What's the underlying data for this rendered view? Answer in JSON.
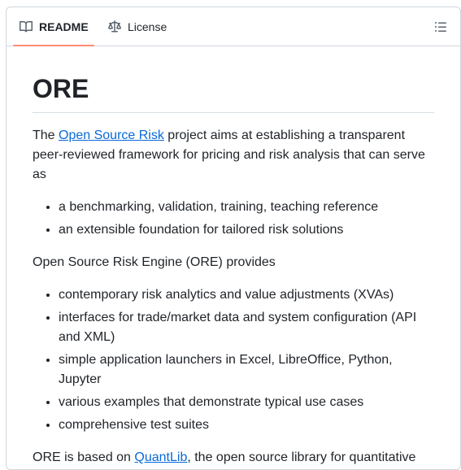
{
  "tabs": {
    "readme": "README",
    "license": "License"
  },
  "readme": {
    "title": "ORE",
    "intro_before": "The ",
    "intro_link": "Open Source Risk",
    "intro_after": " project aims at establishing a transparent peer-reviewed framework for pricing and risk analysis that can serve as",
    "purpose_items": [
      "a benchmarking, validation, training, teaching reference",
      "an extensible foundation for tailored risk solutions"
    ],
    "provides_heading": "Open Source Risk Engine (ORE) provides",
    "provides_items": [
      "contemporary risk analytics and value adjustments (XVAs)",
      "interfaces for trade/market data and system configuration (API and XML)",
      "simple application launchers in Excel, LibreOffice, Python, Jupyter",
      "various examples that demonstrate typical use cases",
      "comprehensive test suites"
    ],
    "based_before": "ORE is based on ",
    "based_link": "QuantLib",
    "based_after": ", the open source library for quantitative"
  },
  "colors": {
    "link": "#0969da",
    "tab_underline": "#fd8c73",
    "border": "#d0d7de"
  },
  "icons": {
    "readme_tab": "book-icon",
    "license_tab": "law-scale-icon",
    "outline": "list-unordered-icon"
  }
}
